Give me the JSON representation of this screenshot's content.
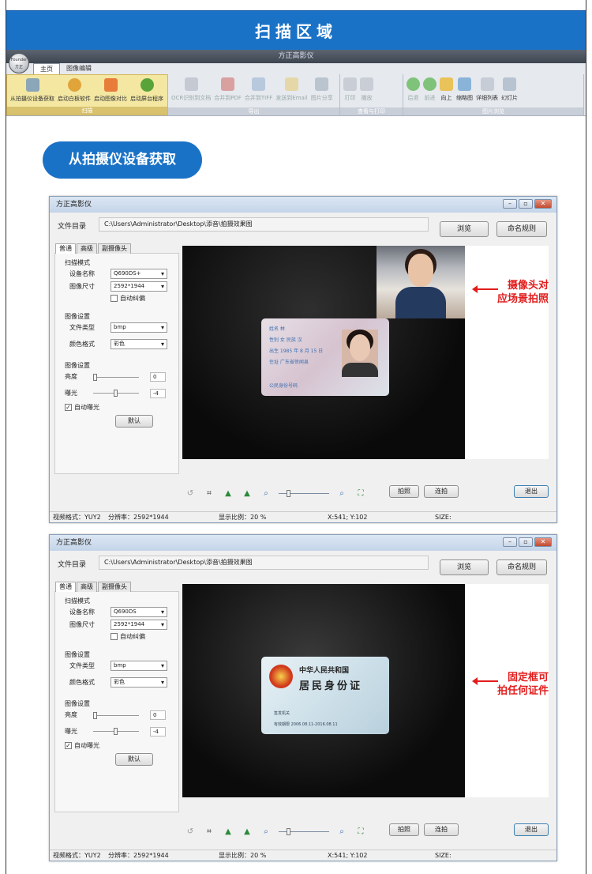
{
  "banner": {
    "title": "扫描区域"
  },
  "ribbon": {
    "app_title": "方正高影仪",
    "orb_label": "Founder 方正",
    "tabs": [
      {
        "label": "主页",
        "active": true
      },
      {
        "label": "图像编辑",
        "active": false
      }
    ],
    "groups": [
      {
        "label": "扫描",
        "items": [
          "从拍摄仪设备获取",
          "启动白板软件",
          "启动图像对比",
          "启动屏台程序"
        ]
      },
      {
        "label": "导出",
        "items": [
          "OCR识别到文档",
          "合并到PDF",
          "合并到TIFF",
          "发送到Email",
          "图片分享"
        ]
      },
      {
        "label": "查看与打印",
        "items": [
          "打印",
          "播放"
        ]
      },
      {
        "label": "图片浏览",
        "items": [
          "后退",
          "前进",
          "向上",
          "缩略图",
          "详细列表",
          "幻灯片"
        ]
      }
    ]
  },
  "section": {
    "title": "从拍摄仪设备获取"
  },
  "windows": [
    {
      "title": "方正高影仪",
      "dir_label": "文件目录",
      "dir_path": "C:\\Users\\Administrator\\Desktop\\添音\\拍摄效果图",
      "browse": "浏览",
      "naming": "命名规则",
      "tabs": [
        "普通",
        "高级",
        "副摄像头"
      ],
      "scan_mode": "扫描模式",
      "device_label": "设备名称",
      "device_value": "Q690DS+",
      "size_label": "图像尺寸",
      "size_value": "2592*1944",
      "autocorrect": "自动纠偏",
      "img_settings": "图像设置",
      "filetype_label": "文件类型",
      "filetype_value": "bmp",
      "color_label": "颜色格式",
      "color_value": "彩色",
      "img_settings2": "图像设置",
      "brightness_label": "亮度",
      "brightness_value": "0",
      "exposure_label": "曝光",
      "exposure_value": "-4",
      "autoexposure": "自动曝光",
      "default": "默认",
      "shoot": "拍照",
      "burst": "连拍",
      "exit": "退出",
      "note": [
        "摄像头对",
        "应场景拍照"
      ],
      "status": {
        "video": "视频格式：YUY2",
        "res": "分辨率：2592*1944",
        "ratio": "显示比例：20 %",
        "xy": "X:541; Y:102",
        "size": "SIZE:"
      }
    },
    {
      "title": "方正高影仪",
      "dir_label": "文件目录",
      "dir_path": "C:\\Users\\Administrator\\Desktop\\添音\\拍摄效果图",
      "browse": "浏览",
      "naming": "命名规则",
      "tabs": [
        "普通",
        "高级",
        "副摄像头"
      ],
      "scan_mode": "扫描模式",
      "device_label": "设备名称",
      "device_value": "Q690DS",
      "size_label": "图像尺寸",
      "size_value": "2592*1944",
      "autocorrect": "自动纠偏",
      "img_settings": "图像设置",
      "filetype_label": "文件类型",
      "filetype_value": "bmp",
      "color_label": "颜色格式",
      "color_value": "彩色",
      "img_settings2": "图像设置",
      "brightness_label": "亮度",
      "brightness_value": "0",
      "exposure_label": "曝光",
      "exposure_value": "-4",
      "autoexposure": "自动曝光",
      "default": "默认",
      "shoot": "拍照",
      "burst": "连拍",
      "exit": "退出",
      "note": [
        "固定框可",
        "拍任何证件"
      ],
      "status": {
        "video": "视频格式：YUY2",
        "res": "分辨率：2592*1944",
        "ratio": "显示比例：20 %",
        "xy": "X:541; Y:102",
        "size": "SIZE:"
      }
    }
  ],
  "idcard": {
    "front_lines": [
      "姓名 林",
      "性别 女 民族 汉",
      "出生 1985 年 8 月 15 日",
      "住址 广东省徐闻县",
      "公民身份号码"
    ],
    "back_line1": "中华人民共和国",
    "back_line2": "居民身份证",
    "back_line3": "签发机关",
    "back_line4": "有效期限 2006.08.11-2016.08.11"
  }
}
